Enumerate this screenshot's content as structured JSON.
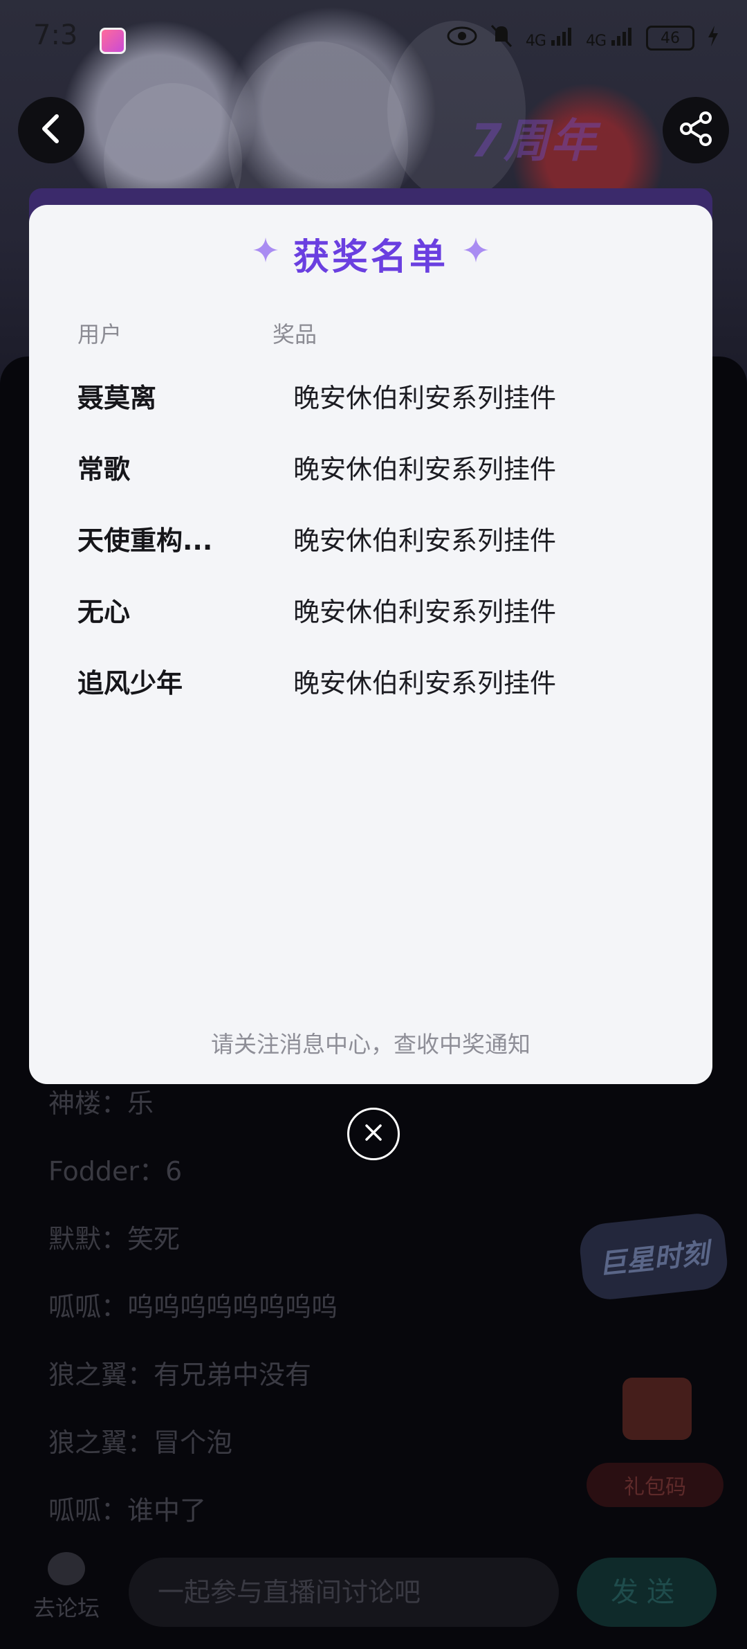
{
  "status_bar": {
    "time": "7:3",
    "network_1": "4G",
    "network_2": "4G",
    "battery": "46"
  },
  "header": {
    "poster_title": "7周年"
  },
  "modal": {
    "title": "获奖名单",
    "columns": {
      "user": "用户",
      "prize": "奖品"
    },
    "winners": [
      {
        "name": "聂莫离",
        "prize": "晚安休伯利安系列挂件"
      },
      {
        "name": "常歌",
        "prize": "晚安休伯利安系列挂件"
      },
      {
        "name": "天使重构...",
        "prize": "晚安休伯利安系列挂件"
      },
      {
        "name": "无心",
        "prize": "晚安休伯利安系列挂件"
      },
      {
        "name": "追风少年",
        "prize": "晚安休伯利安系列挂件"
      }
    ],
    "footer": "请关注消息中心，查收中奖通知"
  },
  "chat": {
    "messages": [
      {
        "user": "神楼",
        "text": "乐"
      },
      {
        "user": "Fodder",
        "text": "6"
      },
      {
        "user": "默默",
        "text": "笑死"
      },
      {
        "user": "呱呱",
        "text": "呜呜呜呜呜呜呜呜"
      },
      {
        "user": "狼之翼",
        "text": "有兄弟中没有"
      },
      {
        "user": "狼之翼",
        "text": "冒个泡"
      },
      {
        "user": "呱呱",
        "text": "谁中了"
      }
    ],
    "separator": "："
  },
  "promo": {
    "badge_text": "巨星时刻",
    "gift_label": "礼包码"
  },
  "bottom_bar": {
    "forum_label": "去论坛",
    "input_placeholder": "一起参与直播间讨论吧",
    "send_label": "发送"
  },
  "colors": {
    "accent": "#6a3fe0",
    "sparkle": "#a98cf2",
    "modal_bg": "#f4f5f8"
  }
}
